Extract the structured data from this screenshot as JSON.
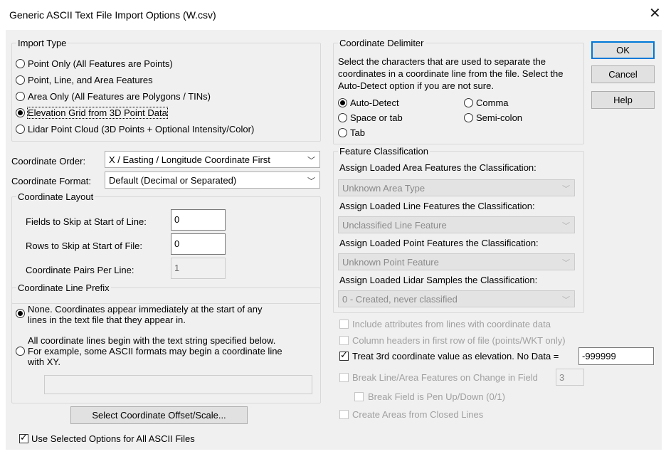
{
  "window": {
    "title": "Generic ASCII Text File Import Options (W.csv)",
    "close_glyph": "✕"
  },
  "import_type": {
    "legend": "Import Type",
    "options": [
      "Point Only (All Features are Points)",
      "Point, Line, and Area Features",
      "Area Only (All Features are Polygons / TINs)",
      "Elevation Grid from 3D Point Data",
      "Lidar Point Cloud (3D Points + Optional Intensity/Color)"
    ],
    "selected": "Elevation Grid from 3D Point Data"
  },
  "coordinate_order": {
    "label": "Coordinate Order:",
    "value": "X / Easting / Longitude Coordinate First"
  },
  "coordinate_format": {
    "label": "Coordinate Format:",
    "value": "Default (Decimal or Separated)"
  },
  "coordinate_layout": {
    "legend": "Coordinate Layout",
    "fields_skip_label": "Fields to Skip at Start of Line:",
    "fields_skip_value": "0",
    "rows_skip_label": "Rows to Skip at Start of File:",
    "rows_skip_value": "0",
    "pairs_label": "Coordinate Pairs Per Line:",
    "pairs_value": "1"
  },
  "line_prefix": {
    "legend": "Coordinate Line Prefix",
    "none_line1": "None. Coordinates appear immediately at the start of any",
    "none_line2": "lines in the text file that they appear in.",
    "text_line1": "All coordinate lines begin with the text string specified below.",
    "text_line2": "For example, some ASCII formats may begin a coordinate line",
    "text_line3": "with XY.",
    "prefix_value": ""
  },
  "offset_button": "Select Coordinate Offset/Scale...",
  "use_all_label": "Use Selected Options for All ASCII Files",
  "delimiter": {
    "legend": "Coordinate Delimiter",
    "desc1": "Select the characters that are used to separate the",
    "desc2": "coordinates in a coordinate line from the file. Select the",
    "desc3": "Auto-Detect option if you are not sure.",
    "auto": "Auto-Detect",
    "space": "Space or tab",
    "tab": "Tab",
    "comma": "Comma",
    "semi": "Semi-colon",
    "selected": "Auto-Detect"
  },
  "classification": {
    "legend": "Feature Classification",
    "area_label": "Assign Loaded Area Features the Classification:",
    "area_value": "Unknown Area Type",
    "line_label": "Assign Loaded Line Features the Classification:",
    "line_value": "Unclassified Line Feature",
    "point_label": "Assign Loaded Point Features the Classification:",
    "point_value": "Unknown Point Feature",
    "lidar_label": "Assign Loaded Lidar Samples the Classification:",
    "lidar_value": "0 - Created, never classified"
  },
  "options": {
    "include_attr": "Include attributes from lines with coordinate data",
    "col_headers": "Column headers in first row of file (points/WKT only)",
    "treat_3rd": "Treat 3rd coordinate value as elevation. No Data =",
    "nodata_value": "-999999",
    "break_line": "Break Line/Area Features on Change in Field",
    "break_field_value": "3",
    "break_pen": "Break Field is Pen Up/Down (0/1)",
    "create_areas": "Create Areas from Closed Lines"
  },
  "buttons": {
    "ok": "OK",
    "cancel": "Cancel",
    "help": "Help"
  }
}
